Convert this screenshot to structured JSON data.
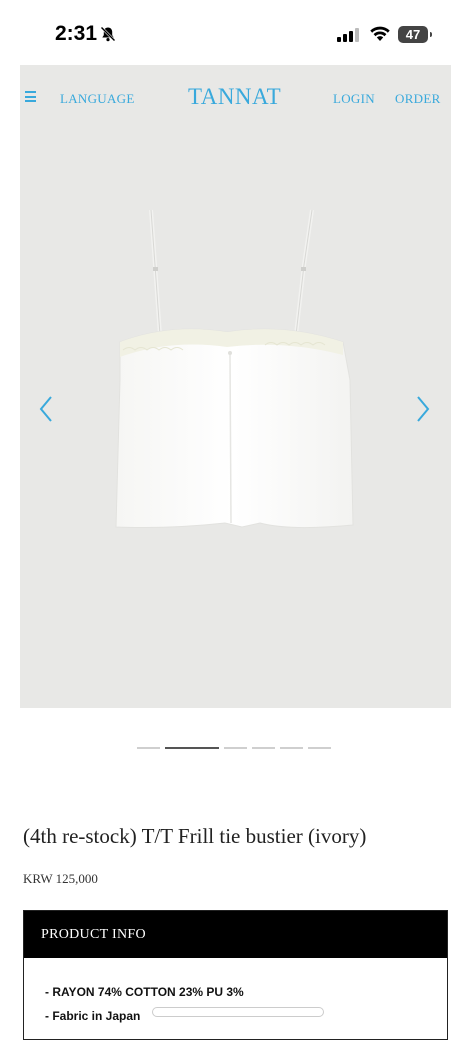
{
  "status": {
    "time": "2:31",
    "battery": "47"
  },
  "nav": {
    "language": "LANGUAGE",
    "logo": "TANNAT",
    "login": "LOGIN",
    "order": "ORDER"
  },
  "carousel": {
    "total_slides": 6,
    "current_slide": 2
  },
  "product": {
    "title": "(4th re-stock) T/T Frill tie bustier (ivory)",
    "price": "KRW 125,000"
  },
  "info": {
    "header": "PRODUCT INFO",
    "lines": [
      "- RAYON 74% COTTON 23% PU 3%",
      "- Fabric in Japan"
    ]
  },
  "colors": {
    "accent": "#39a9dc",
    "hero_bg": "#e8e8e6"
  }
}
